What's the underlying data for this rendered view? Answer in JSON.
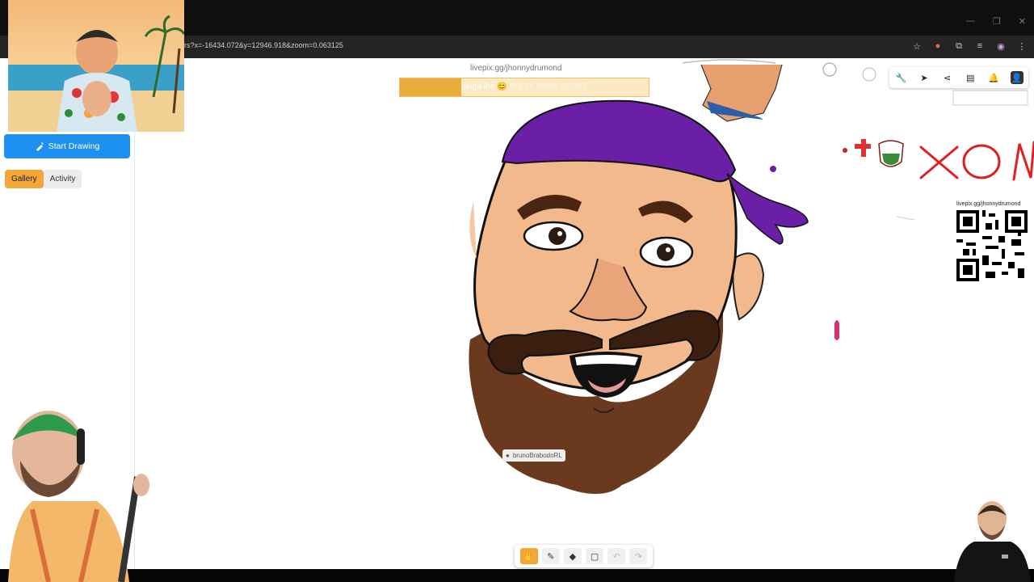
{
  "browser": {
    "url": "rs?x=-16434.072&y=12946.918&zoom=0.063125",
    "window_controls": [
      "—",
      "❐",
      "✕"
    ],
    "icons": [
      "star-icon",
      "extension-icon",
      "puzzle-icon",
      "media-icon",
      "profile-icon",
      "menu-icon"
    ]
  },
  "sidebar": {
    "start_button": "Start Drawing",
    "tabs": [
      {
        "label": "Gallery",
        "active": true
      },
      {
        "label": "Activity",
        "active": false
      }
    ]
  },
  "canvas": {
    "livepix_url": "livepix.gg/jhonnydrumond",
    "goal": {
      "text": "pinga-lhe 😊",
      "amount": "(R$ 24,80/R$ 100,00)",
      "progress": 0.248
    },
    "qr_label": "livepix.gg/jhonnydrumond",
    "author": "brunoBrabodoRL",
    "scribble_text": "XON"
  },
  "right_toolbar": {
    "icons": [
      "wrench-icon",
      "pointer-icon",
      "share-icon",
      "chat-icon",
      "bell-icon",
      "user-icon"
    ]
  },
  "bottom_toolbar": {
    "tools": [
      "hand-icon",
      "pen-icon",
      "eraser-icon",
      "rectangle-icon",
      "undo-icon",
      "redo-icon"
    ],
    "active_tool": "hand-icon"
  },
  "colors": {
    "accent_blue": "#1e90ef",
    "accent_orange": "#f5a638",
    "bandana": "#6a1fa6",
    "skin": "#f1b98c",
    "beard": "#6b3a1e"
  }
}
